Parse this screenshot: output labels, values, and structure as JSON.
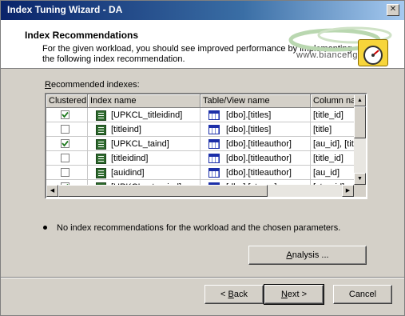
{
  "window": {
    "title": "Index Tuning Wizard - DA",
    "close_glyph": "✕"
  },
  "header": {
    "title": "Index Recommendations",
    "description": "For the given workload,  you should see improved performance by implementing the following index recommendation.",
    "watermark": "www.bianceng.cn"
  },
  "grid": {
    "label_underlined": "R",
    "label_rest": "ecommended indexes:",
    "columns": [
      "Clustered",
      "Index name",
      "Table/View name",
      "Column na"
    ],
    "rows": [
      {
        "clustered": true,
        "index_name": "[UPKCL_titleidind]",
        "table_name": "[dbo].[titles]",
        "columns": "[title_id]"
      },
      {
        "clustered": false,
        "index_name": "[titleind]",
        "table_name": "[dbo].[titles]",
        "columns": "[title]"
      },
      {
        "clustered": true,
        "index_name": "[UPKCL_taind]",
        "table_name": "[dbo].[titleauthor]",
        "columns": "[au_id], [tit"
      },
      {
        "clustered": false,
        "index_name": "[titleidind]",
        "table_name": "[dbo].[titleauthor]",
        "columns": "[title_id]"
      },
      {
        "clustered": false,
        "index_name": "[auidind]",
        "table_name": "[dbo].[titleauthor]",
        "columns": "[au_id]"
      },
      {
        "clustered": true,
        "index_name": "[UPKCL_storeind]",
        "table_name": "[dbo].[stores]",
        "columns": "[stor_id]"
      }
    ]
  },
  "note": "No index recommendations for the workload and the chosen parameters.",
  "buttons": {
    "analysis_underlined": "A",
    "analysis_rest": "nalysis ...",
    "back_prefix": "< ",
    "back_underlined": "B",
    "back_rest": "ack",
    "next_underlined": "N",
    "next_rest": "ext >",
    "cancel": "Cancel"
  }
}
